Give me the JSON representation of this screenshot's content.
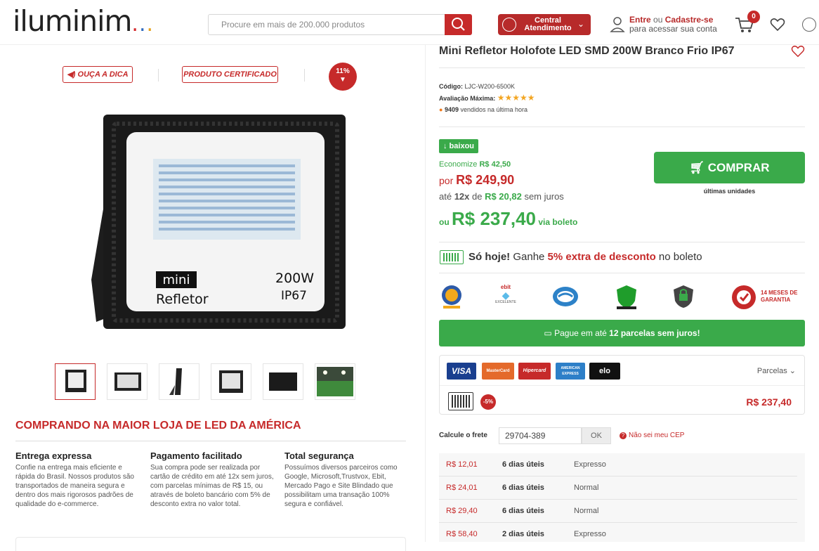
{
  "header": {
    "logo_text": "iluminim",
    "logo_dots": "...",
    "search_placeholder": "Procure em mais de 200.000 produtos",
    "central_line1": "Central",
    "central_line2": "Atendimento",
    "login_entre": "Entre",
    "login_ou": " ou ",
    "login_cadastre": "Cadastre-se",
    "login_line2": "para acessar sua conta",
    "cart_count": "0"
  },
  "left": {
    "tag_ouca": "◀) OUÇA A DICA",
    "tag_certificado": "PRODUTO CERTIFICADO",
    "discount_pct": "11%",
    "product_img_lines": {
      "mini": "mini",
      "refletor": "Refletor",
      "watts": "200W",
      "ip": "IP67"
    },
    "section_title": "COMPRANDO NA MAIOR LOJA DE LED DA AMÉRICA",
    "features": [
      {
        "title": "Entrega expressa",
        "text": "Confie na entrega mais eficiente e rápida do Brasil. Nossos produtos são transportados de maneira segura e dentro dos mais rigorosos padrões de qualidade do e-commerce."
      },
      {
        "title": "Pagamento facilitado",
        "text": "Sua compra pode ser realizada por cartão de crédito em até 12x sem juros, com parcelas mínimas de R$ 15, ou através de boleto bancário com 5% de desconto extra no valor total."
      },
      {
        "title": "Total segurança",
        "text": "Possuímos diversos parceiros como Google, Microsoft,Trustvox, Ebit, Mercado Pago e Site Blindado que possibilitam uma transação 100% segura e confiável."
      }
    ]
  },
  "product": {
    "title": "Mini Refletor Holofote LED SMD 200W Branco Frio IP67",
    "codigo_label": "Código:",
    "codigo": "LJC-W200-6500K",
    "avaliacao_label": "Avaliação Máxima:",
    "rating_stars": 5,
    "vendidos_count": "9409",
    "vendidos_text": " vendidos na última hora",
    "baixou": "↓ baixou",
    "economize_label": "Economize ",
    "economize_value": "R$ 42,50",
    "por_label": "por ",
    "por_value": "R$ 249,90",
    "ate_prefix": "até ",
    "ate_parcelas": "12x",
    "ate_de": " de ",
    "ate_valor": "R$ 20,82",
    "ate_suffix": " sem juros",
    "ou_label": "ou ",
    "boleto_price": "R$ 237,40",
    "boleto_label": " via boleto",
    "comprar": "COMPRAR",
    "ultimas": "últimas unidades",
    "sohoje_bold": "Só hoje!",
    "sohoje_1": " Ganhe ",
    "sohoje_red": "5% extra de desconto",
    "sohoje_2": " no boleto",
    "ebit_label": "ebit",
    "ebit_sub": "EXCELENTE",
    "garantia": "14 MESES DE GARANTIA",
    "pague_1": "Pague em até ",
    "pague_bold": "12 parcelas sem juros!",
    "cards": [
      "VISA",
      "MasterCard",
      "Hipercard",
      "AMERICAN EXPRESS",
      "elo"
    ],
    "parcelas": "Parcelas ⌄",
    "boleto_discount": "-5%",
    "boleto_box_price": "R$ 237,40",
    "frete_label": "Calcule o frete",
    "cep_value": "29704-389",
    "ok": "OK",
    "nao_sei": "Não sei meu CEP",
    "frete_rows": [
      {
        "price": "R$ 12,01",
        "days": "6 dias úteis",
        "type": "Expresso"
      },
      {
        "price": "R$ 24,01",
        "days": "6 dias úteis",
        "type": "Normal"
      },
      {
        "price": "R$ 29,40",
        "days": "6 dias úteis",
        "type": "Normal"
      },
      {
        "price": "R$ 58,40",
        "days": "2 dias úteis",
        "type": "Expresso"
      }
    ]
  },
  "colors": {
    "brand_red": "#c62a2a",
    "green": "#3aaa4a",
    "star": "#f3a623"
  }
}
